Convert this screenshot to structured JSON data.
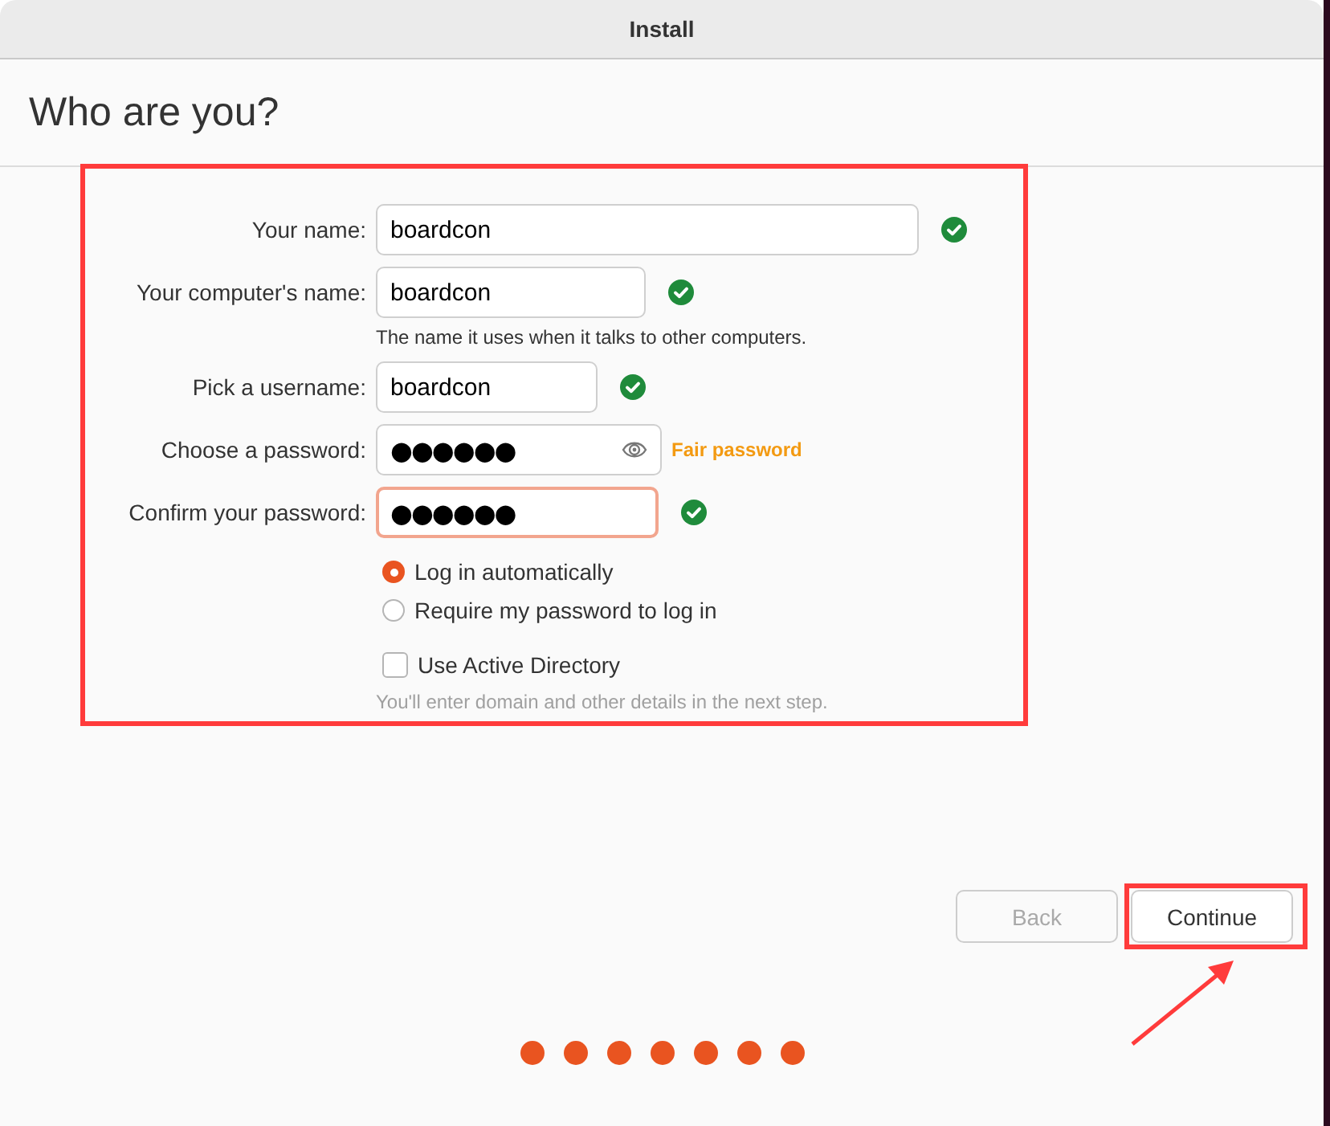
{
  "window": {
    "title": "Install"
  },
  "page": {
    "heading": "Who are you?"
  },
  "fields": [
    {
      "kind": "text",
      "label": "Your name:",
      "value": "boardcon",
      "valid": true,
      "focused": false
    },
    {
      "kind": "text",
      "label": "Your computer's name:",
      "value": "boardcon",
      "valid": true,
      "focused": false,
      "hint": "The name it uses when it talks to other computers."
    },
    {
      "kind": "text",
      "label": "Pick a username:",
      "value": "boardcon",
      "valid": true,
      "focused": false
    },
    {
      "kind": "password",
      "label": "Choose a password:",
      "value": "●●●●●●",
      "valid": false,
      "focused": false,
      "show_toggle": true,
      "strength": "Fair password"
    },
    {
      "kind": "password",
      "label": "Confirm your password:",
      "value": "●●●●●●",
      "valid": true,
      "focused": true,
      "show_toggle": false
    }
  ],
  "login_options": [
    {
      "label": "Log in automatically",
      "selected": true
    },
    {
      "label": "Require my password to log in",
      "selected": false
    }
  ],
  "active_directory": {
    "label": "Use Active Directory",
    "checked": false,
    "hint": "You'll enter domain and other details in the next step."
  },
  "buttons": [
    {
      "label": "Back",
      "disabled": true
    },
    {
      "label": "Continue",
      "disabled": false
    }
  ],
  "progress_steps": [
    {
      "done": true
    },
    {
      "done": true
    },
    {
      "done": true
    },
    {
      "done": true
    },
    {
      "done": true
    },
    {
      "done": true
    },
    {
      "done": true
    }
  ],
  "annotations": {
    "form_frame": true,
    "continue_frame": true,
    "arrow": true
  }
}
